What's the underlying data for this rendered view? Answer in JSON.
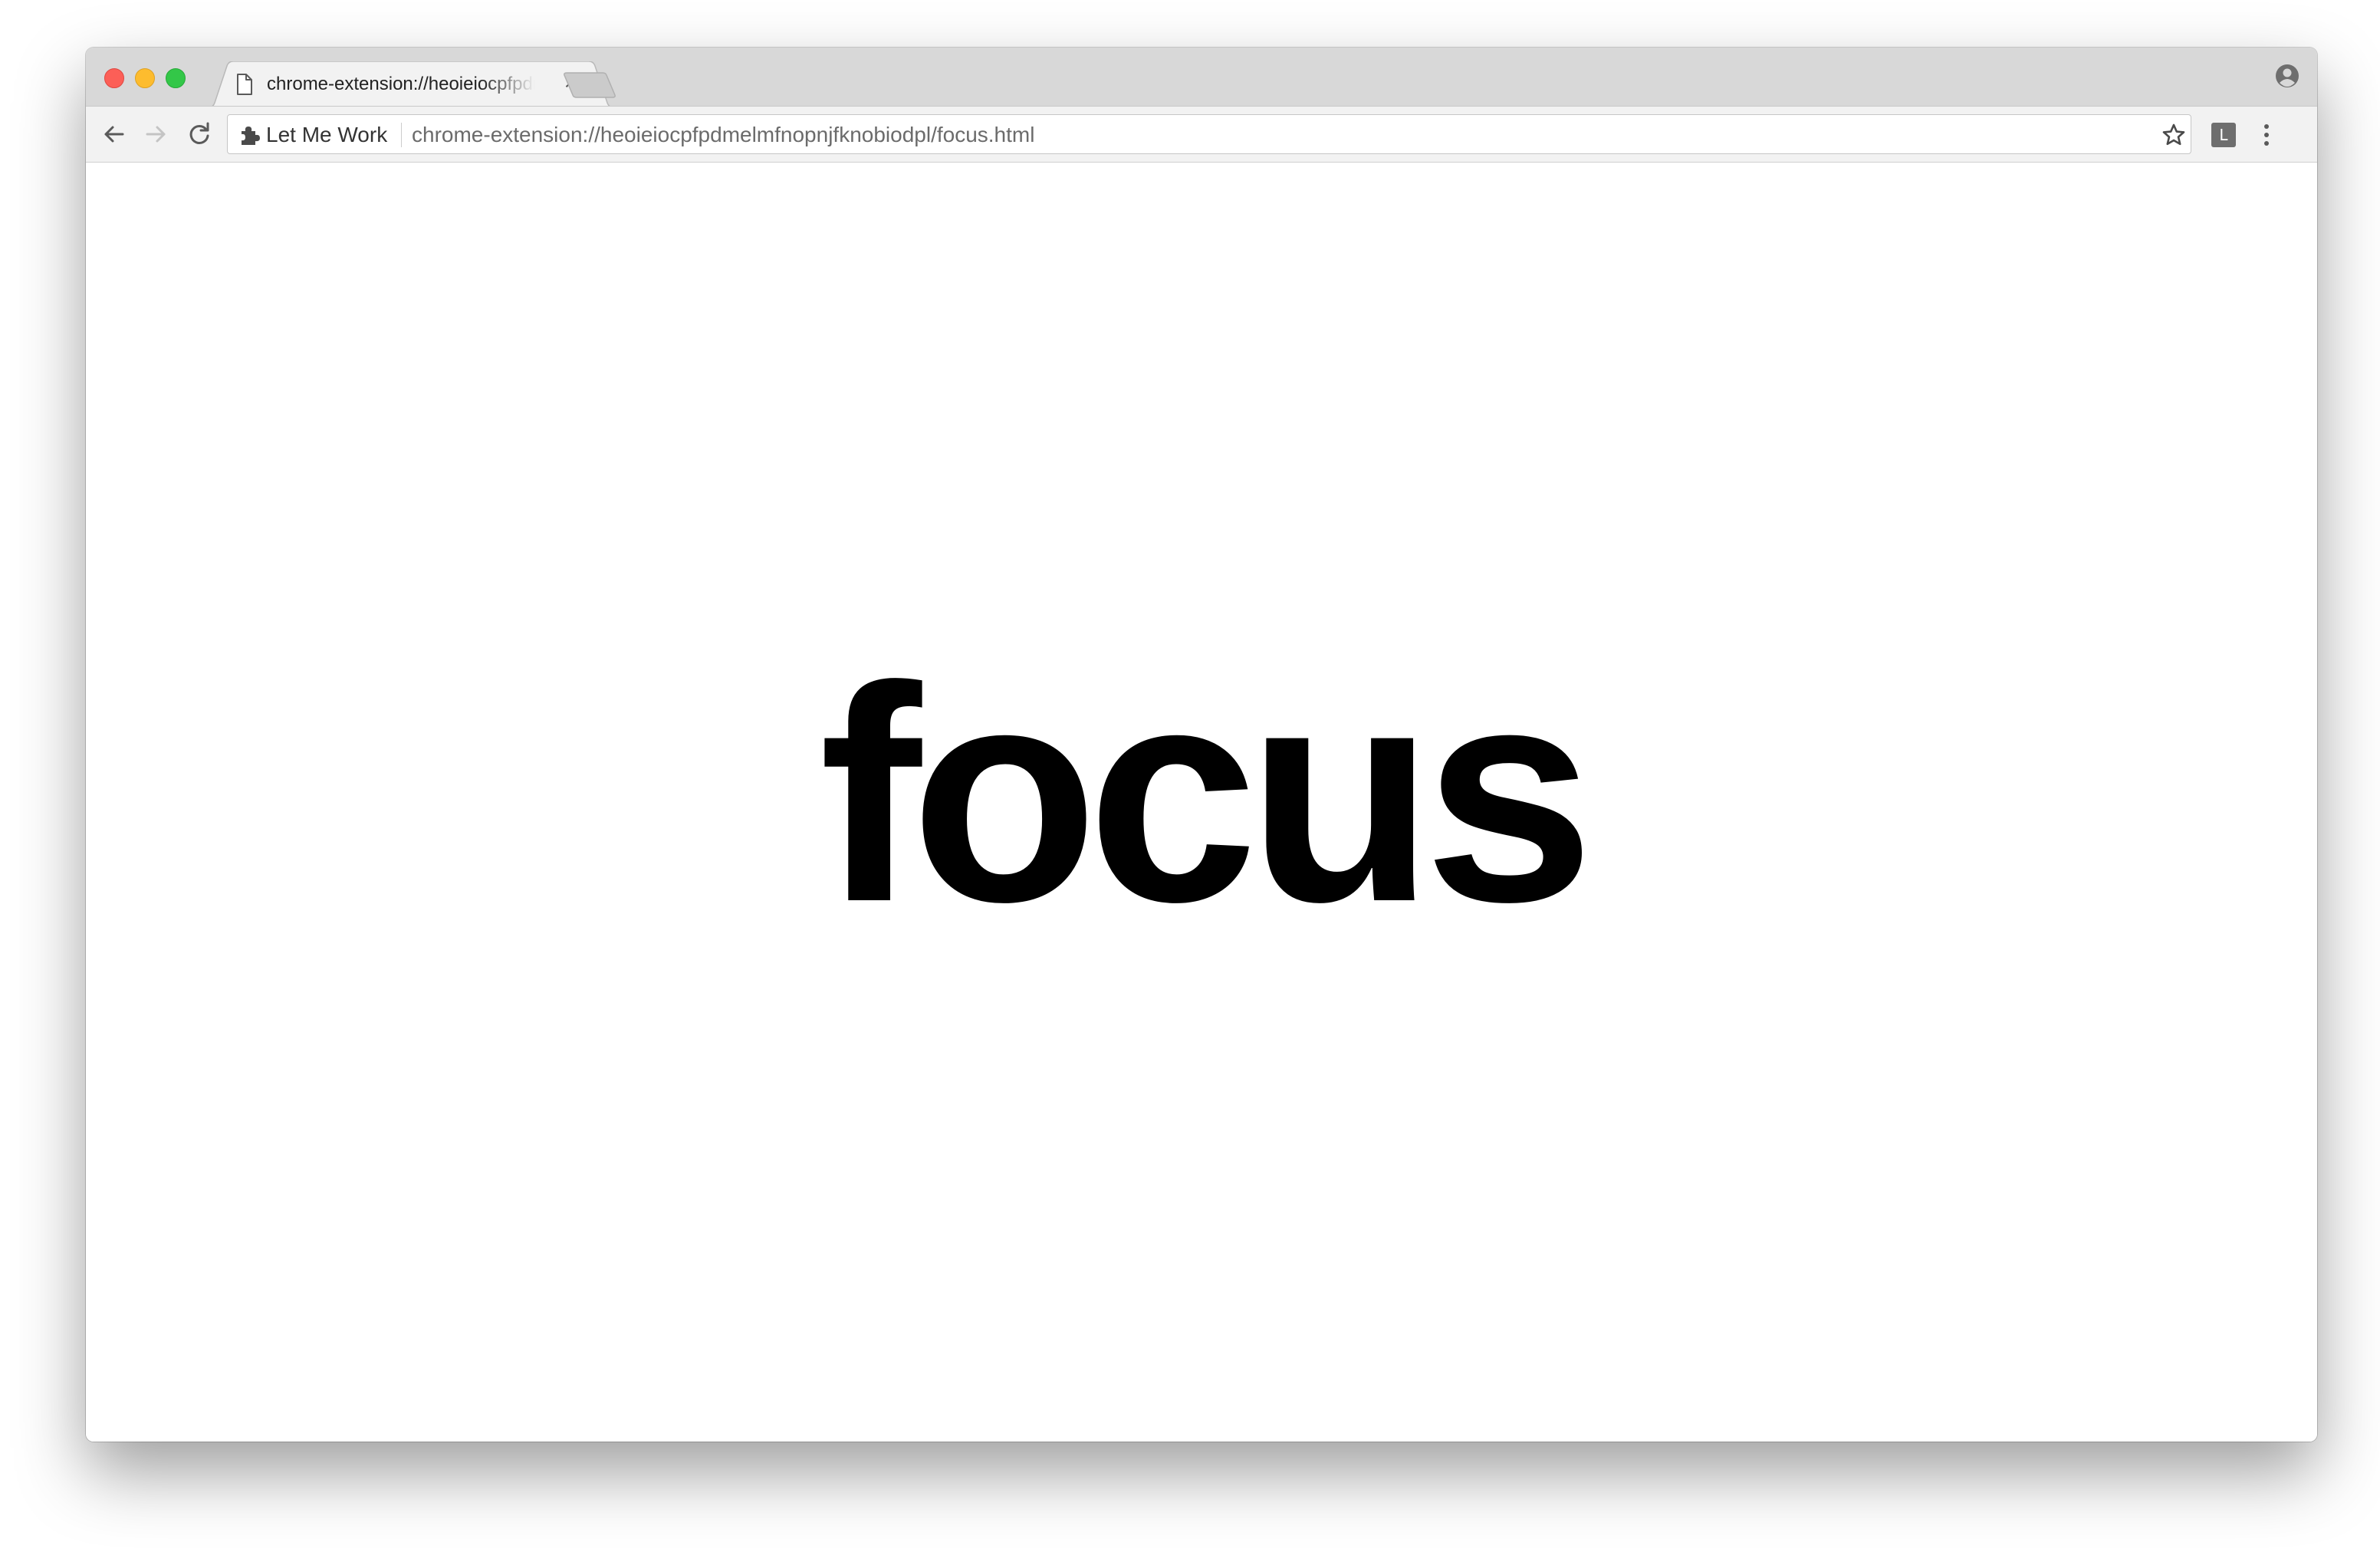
{
  "tab": {
    "title": "chrome-extension://heoieiocpfpdmelmfnopnjfknobiodpl/focus.html",
    "close_glyph": "×"
  },
  "omnibox": {
    "extension_name": "Let Me Work",
    "url": "chrome-extension://heoieiocpfpdmelmfnopnjfknobiodpl/focus.html"
  },
  "extension_button": {
    "label": "L"
  },
  "page": {
    "headline": "focus"
  },
  "icons": {
    "tab_favicon": "page-icon",
    "back": "arrow-left-icon",
    "forward": "arrow-right-icon",
    "reload": "reload-icon",
    "extension": "puzzle-icon",
    "bookmark": "star-icon",
    "menu": "kebab-icon",
    "profile": "account-icon"
  },
  "colors": {
    "titlebar": "#d8d8d8",
    "toolbar": "#f2f2f2",
    "close": "#fc5f57",
    "minimize": "#fdbc2e",
    "maximize": "#33c748",
    "headline": "#000000"
  }
}
